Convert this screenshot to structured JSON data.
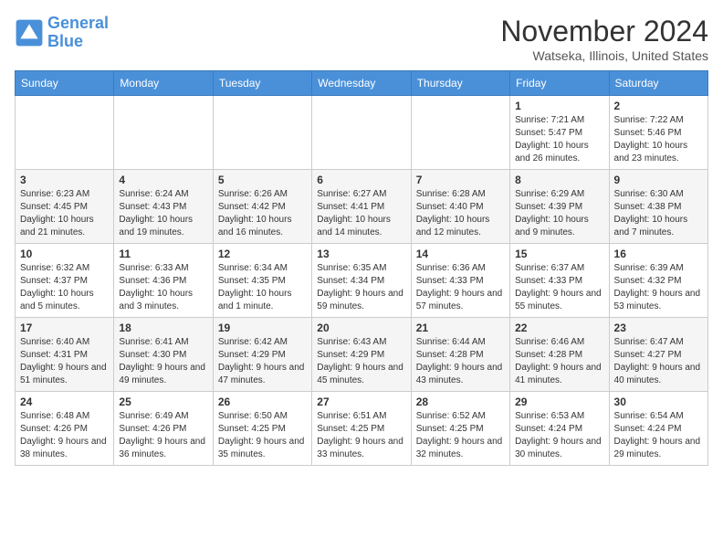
{
  "header": {
    "logo_line1": "General",
    "logo_line2": "Blue",
    "month_title": "November 2024",
    "location": "Watseka, Illinois, United States"
  },
  "weekdays": [
    "Sunday",
    "Monday",
    "Tuesday",
    "Wednesday",
    "Thursday",
    "Friday",
    "Saturday"
  ],
  "weeks": [
    [
      {
        "day": "",
        "info": ""
      },
      {
        "day": "",
        "info": ""
      },
      {
        "day": "",
        "info": ""
      },
      {
        "day": "",
        "info": ""
      },
      {
        "day": "",
        "info": ""
      },
      {
        "day": "1",
        "info": "Sunrise: 7:21 AM\nSunset: 5:47 PM\nDaylight: 10 hours and 26 minutes."
      },
      {
        "day": "2",
        "info": "Sunrise: 7:22 AM\nSunset: 5:46 PM\nDaylight: 10 hours and 23 minutes."
      }
    ],
    [
      {
        "day": "3",
        "info": "Sunrise: 6:23 AM\nSunset: 4:45 PM\nDaylight: 10 hours and 21 minutes."
      },
      {
        "day": "4",
        "info": "Sunrise: 6:24 AM\nSunset: 4:43 PM\nDaylight: 10 hours and 19 minutes."
      },
      {
        "day": "5",
        "info": "Sunrise: 6:26 AM\nSunset: 4:42 PM\nDaylight: 10 hours and 16 minutes."
      },
      {
        "day": "6",
        "info": "Sunrise: 6:27 AM\nSunset: 4:41 PM\nDaylight: 10 hours and 14 minutes."
      },
      {
        "day": "7",
        "info": "Sunrise: 6:28 AM\nSunset: 4:40 PM\nDaylight: 10 hours and 12 minutes."
      },
      {
        "day": "8",
        "info": "Sunrise: 6:29 AM\nSunset: 4:39 PM\nDaylight: 10 hours and 9 minutes."
      },
      {
        "day": "9",
        "info": "Sunrise: 6:30 AM\nSunset: 4:38 PM\nDaylight: 10 hours and 7 minutes."
      }
    ],
    [
      {
        "day": "10",
        "info": "Sunrise: 6:32 AM\nSunset: 4:37 PM\nDaylight: 10 hours and 5 minutes."
      },
      {
        "day": "11",
        "info": "Sunrise: 6:33 AM\nSunset: 4:36 PM\nDaylight: 10 hours and 3 minutes."
      },
      {
        "day": "12",
        "info": "Sunrise: 6:34 AM\nSunset: 4:35 PM\nDaylight: 10 hours and 1 minute."
      },
      {
        "day": "13",
        "info": "Sunrise: 6:35 AM\nSunset: 4:34 PM\nDaylight: 9 hours and 59 minutes."
      },
      {
        "day": "14",
        "info": "Sunrise: 6:36 AM\nSunset: 4:33 PM\nDaylight: 9 hours and 57 minutes."
      },
      {
        "day": "15",
        "info": "Sunrise: 6:37 AM\nSunset: 4:33 PM\nDaylight: 9 hours and 55 minutes."
      },
      {
        "day": "16",
        "info": "Sunrise: 6:39 AM\nSunset: 4:32 PM\nDaylight: 9 hours and 53 minutes."
      }
    ],
    [
      {
        "day": "17",
        "info": "Sunrise: 6:40 AM\nSunset: 4:31 PM\nDaylight: 9 hours and 51 minutes."
      },
      {
        "day": "18",
        "info": "Sunrise: 6:41 AM\nSunset: 4:30 PM\nDaylight: 9 hours and 49 minutes."
      },
      {
        "day": "19",
        "info": "Sunrise: 6:42 AM\nSunset: 4:29 PM\nDaylight: 9 hours and 47 minutes."
      },
      {
        "day": "20",
        "info": "Sunrise: 6:43 AM\nSunset: 4:29 PM\nDaylight: 9 hours and 45 minutes."
      },
      {
        "day": "21",
        "info": "Sunrise: 6:44 AM\nSunset: 4:28 PM\nDaylight: 9 hours and 43 minutes."
      },
      {
        "day": "22",
        "info": "Sunrise: 6:46 AM\nSunset: 4:28 PM\nDaylight: 9 hours and 41 minutes."
      },
      {
        "day": "23",
        "info": "Sunrise: 6:47 AM\nSunset: 4:27 PM\nDaylight: 9 hours and 40 minutes."
      }
    ],
    [
      {
        "day": "24",
        "info": "Sunrise: 6:48 AM\nSunset: 4:26 PM\nDaylight: 9 hours and 38 minutes."
      },
      {
        "day": "25",
        "info": "Sunrise: 6:49 AM\nSunset: 4:26 PM\nDaylight: 9 hours and 36 minutes."
      },
      {
        "day": "26",
        "info": "Sunrise: 6:50 AM\nSunset: 4:25 PM\nDaylight: 9 hours and 35 minutes."
      },
      {
        "day": "27",
        "info": "Sunrise: 6:51 AM\nSunset: 4:25 PM\nDaylight: 9 hours and 33 minutes."
      },
      {
        "day": "28",
        "info": "Sunrise: 6:52 AM\nSunset: 4:25 PM\nDaylight: 9 hours and 32 minutes."
      },
      {
        "day": "29",
        "info": "Sunrise: 6:53 AM\nSunset: 4:24 PM\nDaylight: 9 hours and 30 minutes."
      },
      {
        "day": "30",
        "info": "Sunrise: 6:54 AM\nSunset: 4:24 PM\nDaylight: 9 hours and 29 minutes."
      }
    ]
  ]
}
